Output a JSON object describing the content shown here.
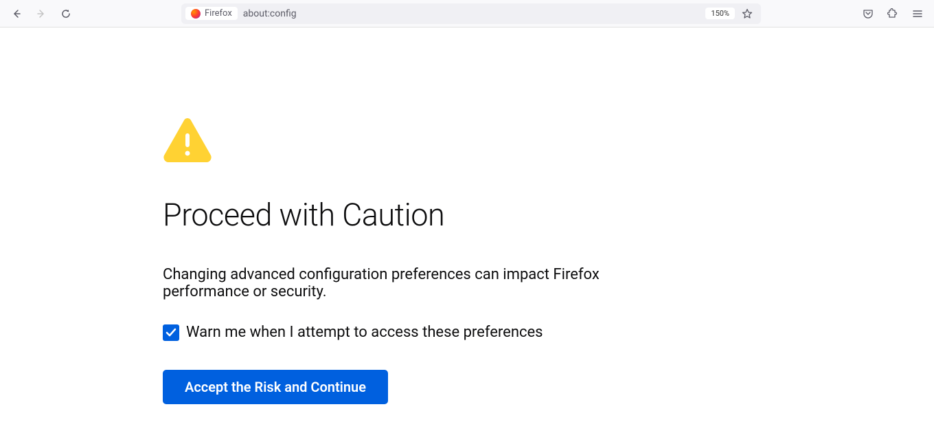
{
  "toolbar": {
    "identity_label": "Firefox",
    "url": "about:config",
    "zoom": "150%"
  },
  "content": {
    "title": "Proceed with Caution",
    "description": "Changing advanced configuration preferences can impact Firefox performance or security.",
    "checkbox_label": "Warn me when I attempt to access these preferences",
    "checkbox_checked": true,
    "button_label": "Accept the Risk and Continue"
  }
}
